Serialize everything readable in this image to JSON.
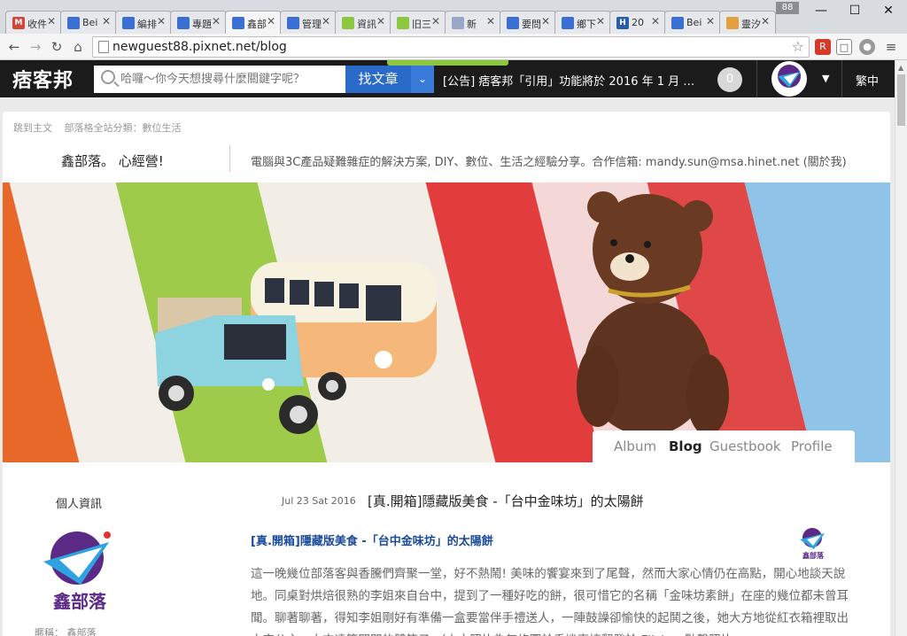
{
  "browser": {
    "tabs": [
      {
        "title": "收件",
        "icon_color": "#d44638",
        "icon_text": "M"
      },
      {
        "title": "Bei",
        "icon_color": "#3b6fd4",
        "icon_text": ""
      },
      {
        "title": "編排",
        "icon_color": "#3b6fd4",
        "icon_text": ""
      },
      {
        "title": "專題",
        "icon_color": "#3b6fd4",
        "icon_text": ""
      },
      {
        "title": "鑫部",
        "icon_color": "#3b6fd4",
        "icon_text": ""
      },
      {
        "title": "管理",
        "icon_color": "#3b6fd4",
        "icon_text": ""
      },
      {
        "title": "資訊",
        "icon_color": "#8dc63f",
        "icon_text": ""
      },
      {
        "title": "旧三",
        "icon_color": "#8dc63f",
        "icon_text": ""
      },
      {
        "title": "新",
        "icon_color": "#9aa6c8",
        "icon_text": ""
      },
      {
        "title": "要問",
        "icon_color": "#3b6fd4",
        "icon_text": ""
      },
      {
        "title": "鄉下",
        "icon_color": "#3b6fd4",
        "icon_text": ""
      },
      {
        "title": "20",
        "icon_color": "#2b5ea8",
        "icon_text": "H"
      },
      {
        "title": "Bei",
        "icon_color": "#3b6fd4",
        "icon_text": ""
      },
      {
        "title": "靈汐",
        "icon_color": "#e2a03f",
        "icon_text": ""
      }
    ],
    "active_tab": 4,
    "tab_count_badge": "88",
    "address": "newguest88.pixnet.net/blog",
    "minimize": "—",
    "maximize": "☐",
    "close": "✕"
  },
  "pixnet": {
    "logo_text": "痞客邦",
    "search_placeholder": "哈囉～你今天想搜尋什麼關鍵字呢？",
    "search_button": "找文章",
    "announcement": "[公告] 痞客邦「引用」功能將於 2016 年 1 月 …",
    "notification_count": "0",
    "language": "繁中"
  },
  "blog": {
    "crumbs": [
      "跳到主文",
      "部落格全站分類：數位生活"
    ],
    "name": "鑫部落。 心經營!",
    "description": "電腦與3C產品疑難雜症的解決方案, DIY、數位、生活之經驗分享。合作信箱: mandy.sun@msa.hinet.net (關於我)",
    "nav": [
      "Album",
      "Blog",
      "Guestbook",
      "Profile"
    ],
    "nav_active": "Blog",
    "sidebar_title": "個人資訊",
    "logo_caption": "鑫部落",
    "nickname": "暱稱： 鑫部落"
  },
  "post": {
    "date": "Jul 23 Sat 2016",
    "title": "[真.開箱]隱藏版美食 -「台中金味坊」的太陽餅",
    "link_title": "[真.開箱]隱藏版美食 -「台中金味坊」的太陽餅",
    "mini_caption": "鑫部落",
    "body": "這一晚幾位部落客與香騰們齊聚一堂，好不熱鬧! 美味的饗宴來到了尾聲，然而大家心情仍在高點，開心地談天說地。同桌對烘焙很熟的李姐來自台中，提到了一種好吃的餅，很可惜它的名稱「金味坊素餅」在座的幾位都未曾耳聞。聊著聊著，得知李姐剛好有準備一盒要當伴手禮送人，一陣鼓譟卻愉快的起鬨之後，她大方地從紅衣箱裡取出太空公主，大方遠算開開的體箱子 （本文照片為無修圖於手機直接翻發於 Flickr，點擊照片"
  },
  "colors": {
    "pixbar": "#1b1b1b",
    "search_button": "#2a6ac8",
    "link": "#1a4a9c",
    "accent_green": "#8dc63f"
  }
}
